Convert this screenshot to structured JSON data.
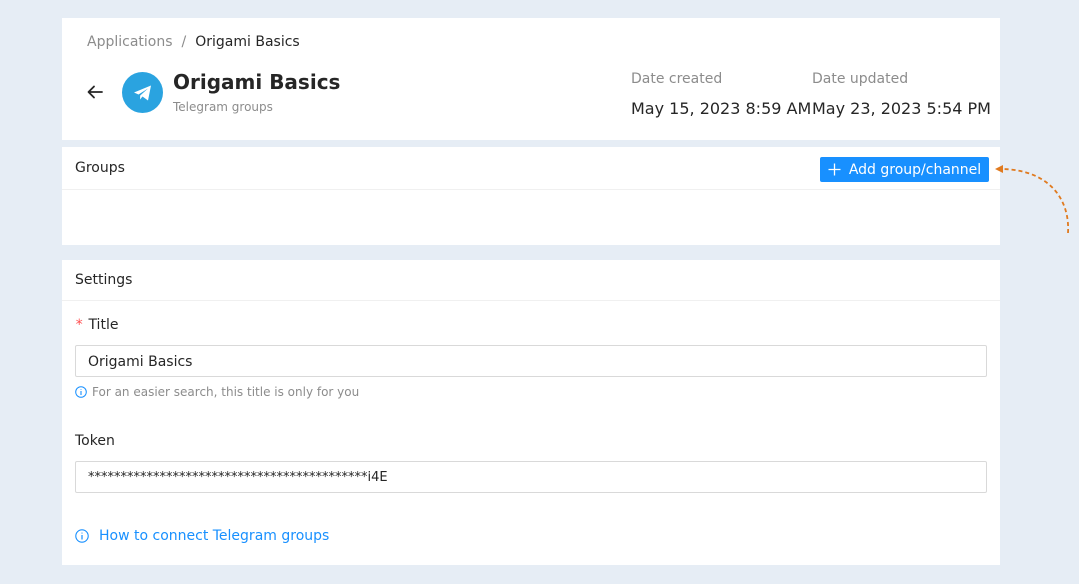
{
  "breadcrumb": {
    "root": "Applications",
    "separator": "/",
    "current": "Origami Basics"
  },
  "header": {
    "back_icon": "arrow-left-icon",
    "app_icon": "telegram-icon",
    "title": "Origami Basics",
    "subtitle": "Telegram groups",
    "date_created_label": "Date created",
    "date_created_value": "May 15, 2023 8:59 AM",
    "date_updated_label": "Date updated",
    "date_updated_value": "May 23, 2023 5:54 PM"
  },
  "groups": {
    "title": "Groups",
    "add_button_label": "Add group/channel",
    "add_icon": "plus-icon"
  },
  "settings": {
    "title": "Settings",
    "title_field": {
      "label": "Title",
      "required_mark": "*",
      "value": "Origami Basics",
      "help": "For an easier search, this title is only for you"
    },
    "token_field": {
      "label": "Token",
      "value": "*******************************************i4E"
    },
    "help_link": "How to connect Telegram groups"
  },
  "colors": {
    "accent": "#1890ff",
    "telegram": "#2aa3e0",
    "annotation": "#e07a1f",
    "background": "#e6edf5"
  }
}
